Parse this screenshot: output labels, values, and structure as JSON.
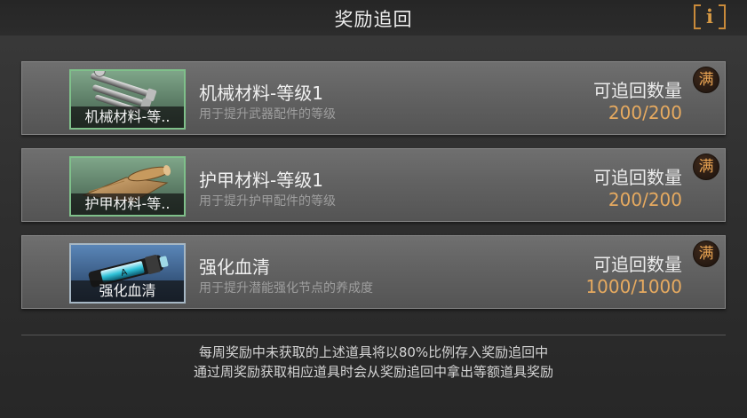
{
  "header": {
    "title": "奖励追回",
    "info_icon": "info-icon"
  },
  "items": [
    {
      "thumb_label": "机械材料-等..",
      "name": "机械材料-等级1",
      "desc": "用于提升武器配件的等级",
      "recover_label": "可追回数量",
      "count": "200/200",
      "badge": "满",
      "icon": "mechanical-parts-icon",
      "frame_color": "#7fc08a"
    },
    {
      "thumb_label": "护甲材料-等..",
      "name": "护甲材料-等级1",
      "desc": "用于提升护甲配件的等级",
      "recover_label": "可追回数量",
      "count": "200/200",
      "badge": "满",
      "icon": "armor-cloth-icon",
      "frame_color": "#7fc08a"
    },
    {
      "thumb_label": "强化血清",
      "name": "强化血清",
      "desc": "用于提升潜能强化节点的养成度",
      "recover_label": "可追回数量",
      "count": "1000/1000",
      "badge": "满",
      "icon": "serum-vial-icon",
      "frame_color": "#a6b7c4"
    }
  ],
  "footer": {
    "line1": "每周奖励中未获取的上述道具将以80%比例存入奖励追回中",
    "line2": "通过周奖励获取相应道具时会从奖励追回中拿出等额道具奖励"
  },
  "colors": {
    "accent": "#e6aa60",
    "badge_text": "#e8a352",
    "frame_green": "#7fc08a"
  }
}
